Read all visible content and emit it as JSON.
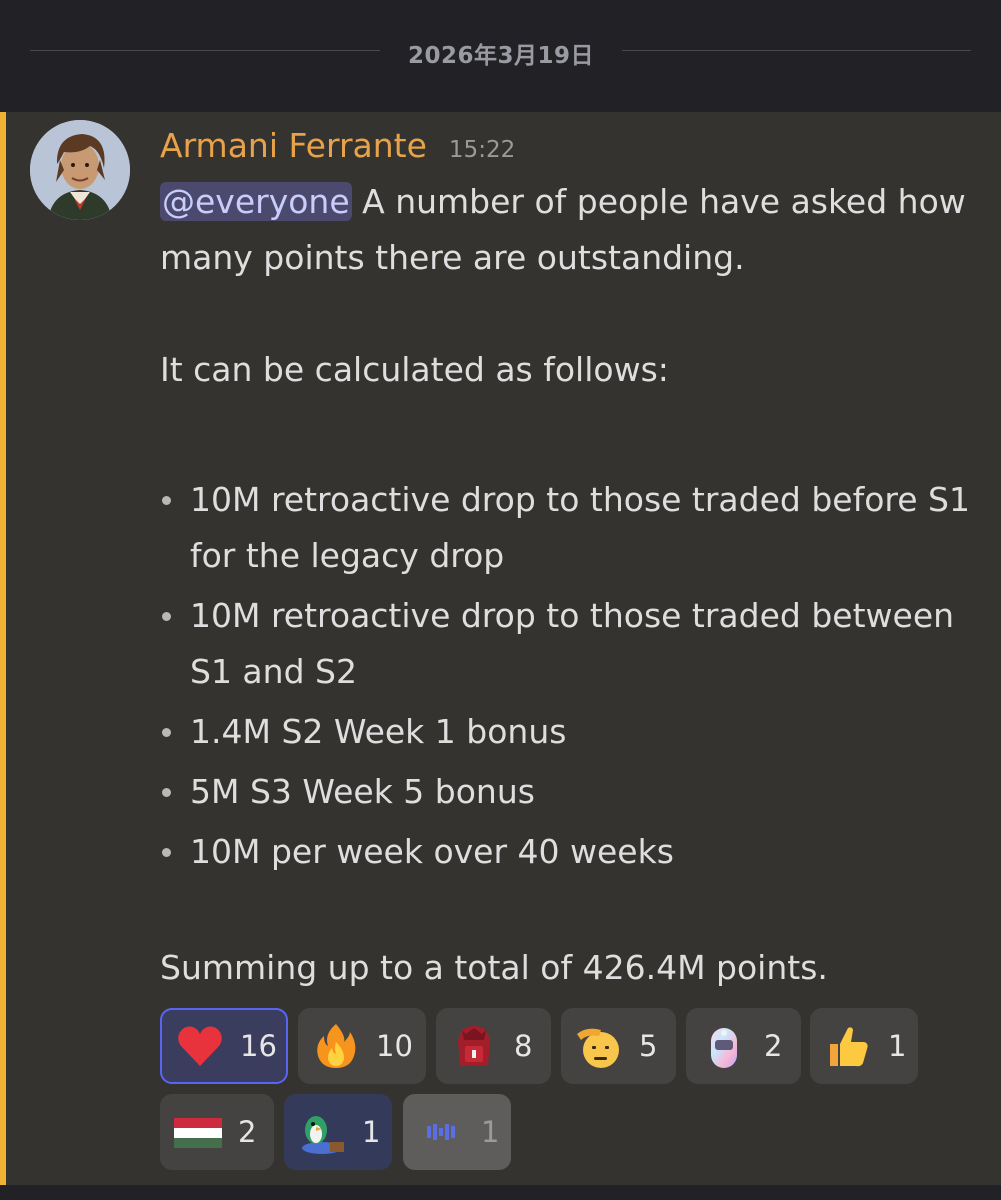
{
  "date_separator": "2026年3月19日",
  "message": {
    "author": "Armani Ferrante",
    "timestamp": "15:22",
    "mention": "@everyone",
    "intro": " A number of people have asked how many points there are outstanding.",
    "calc_line": "It can be calculated as follows:",
    "bullets": [
      "10M retroactive drop to those traded before S1 for the legacy drop",
      "10M retroactive drop to those traded between S1 and S2",
      "1.4M S2 Week 1 bonus",
      "5M S3 Week 5 bonus",
      "10M per week over 40 weeks"
    ],
    "summary": "Summing up to a total of 426.4M points."
  },
  "reactions": [
    {
      "emoji": "heart-icon",
      "count": "16",
      "active": true
    },
    {
      "emoji": "fire-icon",
      "count": "10"
    },
    {
      "emoji": "red-backpack-icon",
      "count": "8"
    },
    {
      "emoji": "saluting-face-icon",
      "count": "5"
    },
    {
      "emoji": "holographic-capsule-icon",
      "count": "2"
    },
    {
      "emoji": "thumbs-up-icon",
      "count": "1"
    },
    {
      "emoji": "hungary-flag-icon",
      "count": "2"
    },
    {
      "emoji": "penguin-dj-icon",
      "count": "1"
    },
    {
      "emoji": "pixel-emblem-icon",
      "count": "1"
    }
  ],
  "colors": {
    "mention_bar": "#f0b232",
    "author": "#e8a24a",
    "active_reaction_border": "#5865f2"
  }
}
